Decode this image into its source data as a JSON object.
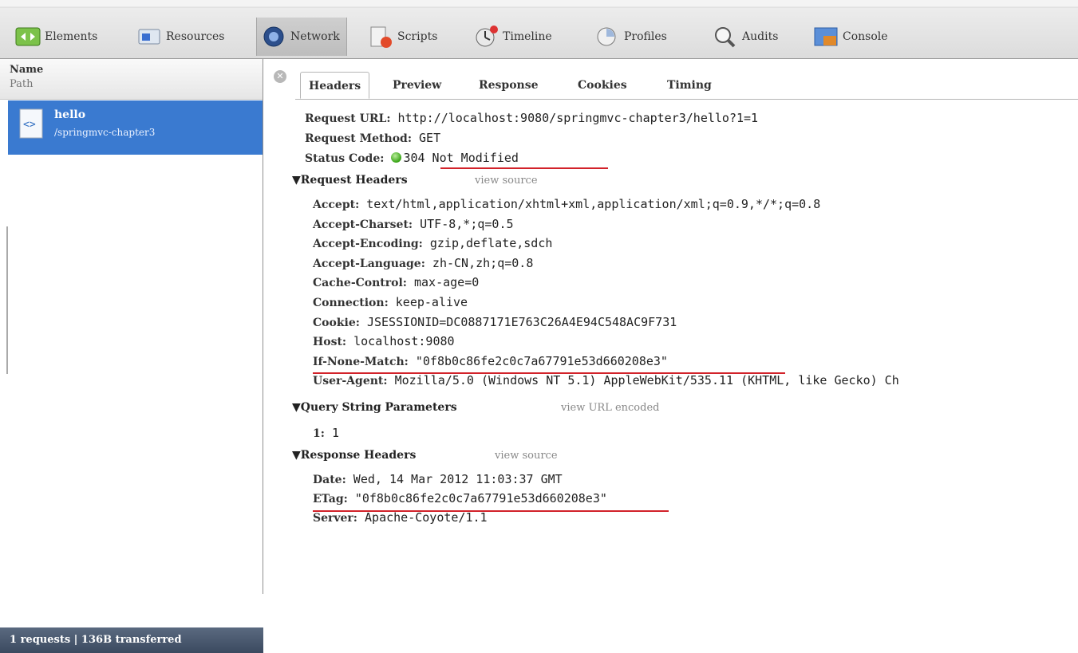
{
  "toolbar": {
    "items": [
      {
        "label": "Elements",
        "icon": "elements-icon"
      },
      {
        "label": "Resources",
        "icon": "resources-icon"
      },
      {
        "label": "Network",
        "icon": "network-icon"
      },
      {
        "label": "Scripts",
        "icon": "scripts-icon"
      },
      {
        "label": "Timeline",
        "icon": "timeline-icon"
      },
      {
        "label": "Profiles",
        "icon": "profiles-icon"
      },
      {
        "label": "Audits",
        "icon": "audits-icon"
      },
      {
        "label": "Console",
        "icon": "console-icon"
      }
    ],
    "active": "Network"
  },
  "sidebar": {
    "col_name": "Name",
    "col_path": "Path",
    "request": {
      "name": "hello",
      "path": "/springmvc-chapter3",
      "icon": "html-file-icon"
    },
    "status": "1 requests  |  136B transferred"
  },
  "tabs": [
    "Headers",
    "Preview",
    "Response",
    "Cookies",
    "Timing"
  ],
  "active_tab": "Headers",
  "general": {
    "request_url_key": "Request URL:",
    "request_url": "http://localhost:9080/springmvc-chapter3/hello?1=1",
    "method_key": "Request Method:",
    "method": "GET",
    "status_key": "Status Code:",
    "status": "304 Not Modified"
  },
  "request_headers": {
    "title": "Request Headers",
    "link": "view source",
    "rows": [
      {
        "k": "Accept:",
        "v": "text/html,application/xhtml+xml,application/xml;q=0.9,*/*;q=0.8"
      },
      {
        "k": "Accept-Charset:",
        "v": "UTF-8,*;q=0.5"
      },
      {
        "k": "Accept-Encoding:",
        "v": "gzip,deflate,sdch"
      },
      {
        "k": "Accept-Language:",
        "v": "zh-CN,zh;q=0.8"
      },
      {
        "k": "Cache-Control:",
        "v": "max-age=0"
      },
      {
        "k": "Connection:",
        "v": "keep-alive"
      },
      {
        "k": "Cookie:",
        "v": "JSESSIONID=DC0887171E763C26A4E94C548AC9F731"
      },
      {
        "k": "Host:",
        "v": "localhost:9080"
      },
      {
        "k": "If-None-Match:",
        "v": "\"0f8b0c86fe2c0c7a67791e53d660208e3\""
      },
      {
        "k": "User-Agent:",
        "v": "Mozilla/5.0 (Windows NT 5.1) AppleWebKit/535.11 (KHTML, like Gecko) Ch"
      }
    ]
  },
  "query": {
    "title": "Query String Parameters",
    "link": "view URL encoded",
    "rows": [
      {
        "k": "1:",
        "v": "1"
      }
    ]
  },
  "response_headers": {
    "title": "Response Headers",
    "link": "view source",
    "rows": [
      {
        "k": "Date:",
        "v": "Wed, 14 Mar 2012 11:03:37 GMT"
      },
      {
        "k": "ETag:",
        "v": "\"0f8b0c86fe2c0c7a67791e53d660208e3\""
      },
      {
        "k": "Server:",
        "v": "Apache-Coyote/1.1"
      }
    ]
  },
  "colors": {
    "selection": "#3a7ad0",
    "underline": "#d2222a",
    "status_ok": "#36a314"
  }
}
